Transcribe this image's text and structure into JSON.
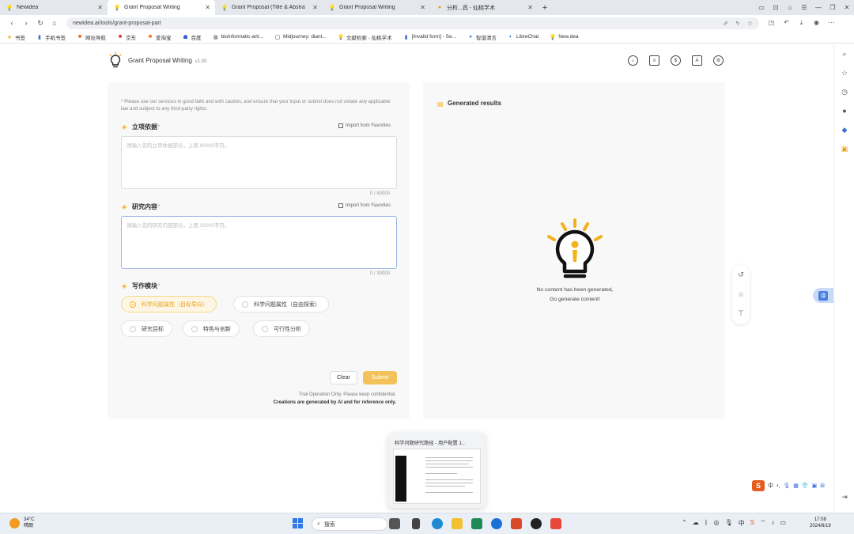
{
  "browser": {
    "tabs": [
      {
        "title": "Newidea",
        "active": false
      },
      {
        "title": "Grant Proposal Writing",
        "active": true
      },
      {
        "title": "Grant Proposal (Title & Abstra",
        "active": false
      },
      {
        "title": "Grant Proposal Writing",
        "active": false
      },
      {
        "title": "分析...具 - 仙桃学术",
        "active": false
      }
    ],
    "url": "newidea.ai/tools/grant-proposal-part",
    "bookmarks": [
      "书签",
      "手机书签",
      "网址导航",
      "京东",
      "爱淘宝",
      "百度",
      "bioinformatic-arti...",
      "Midjourney: diant...",
      "文献检索 - 仙桃学术",
      "[Invalid form] - Se...",
      "智谱清言",
      "LibreChat",
      "New.dea"
    ]
  },
  "app": {
    "title": "Grant Proposal Writing",
    "version": "v1.00"
  },
  "form": {
    "notice": "* Please use our services in good faith and with caution, and ensure that your input or submit does not violate any applicable law and subject to any third-party rights.",
    "section1": {
      "title": "立项依据",
      "required": "*",
      "import": "Import from Favorites",
      "placeholder": "请输入您的立项依据部分，上限 80000字符。",
      "counter": "0 / 80000"
    },
    "section2": {
      "title": "研究内容",
      "required": "*",
      "import": "Import from Favorites",
      "placeholder": "请输入您的研究内容部分，上限 30000字符。",
      "counter": "0 / 30000"
    },
    "section3": {
      "title": "写作模块",
      "required": "*",
      "options_row1": [
        {
          "label": "科学问题属性（目标导向）",
          "selected": true
        },
        {
          "label": "科学问题属性（自由探索）",
          "selected": false
        }
      ],
      "options_row2": [
        {
          "label": "研究目标",
          "selected": false
        },
        {
          "label": "特色与创新",
          "selected": false
        },
        {
          "label": "可行性分析",
          "selected": false
        }
      ]
    },
    "clear_label": "Clear",
    "submit_label": "Submit",
    "disclaimer1": "Trial Operation Only. Please keep confidential.",
    "disclaimer2": "Creations are generated by AI and for reference only."
  },
  "results": {
    "title": "Generated results",
    "empty_line1": "No content has been generated,",
    "empty_line2": "Go generate content!"
  },
  "thumbnail": {
    "title": "科学问题研究路径 - 用户配置 1..."
  },
  "taskbar": {
    "temp": "34°C",
    "weather": "晴朗",
    "search": "搜索",
    "time": "17:08",
    "date": "2024/8/19"
  },
  "ime": {
    "lang": "中"
  },
  "colors": {
    "accent": "#f3b21c",
    "submit": "#f3c25a"
  }
}
